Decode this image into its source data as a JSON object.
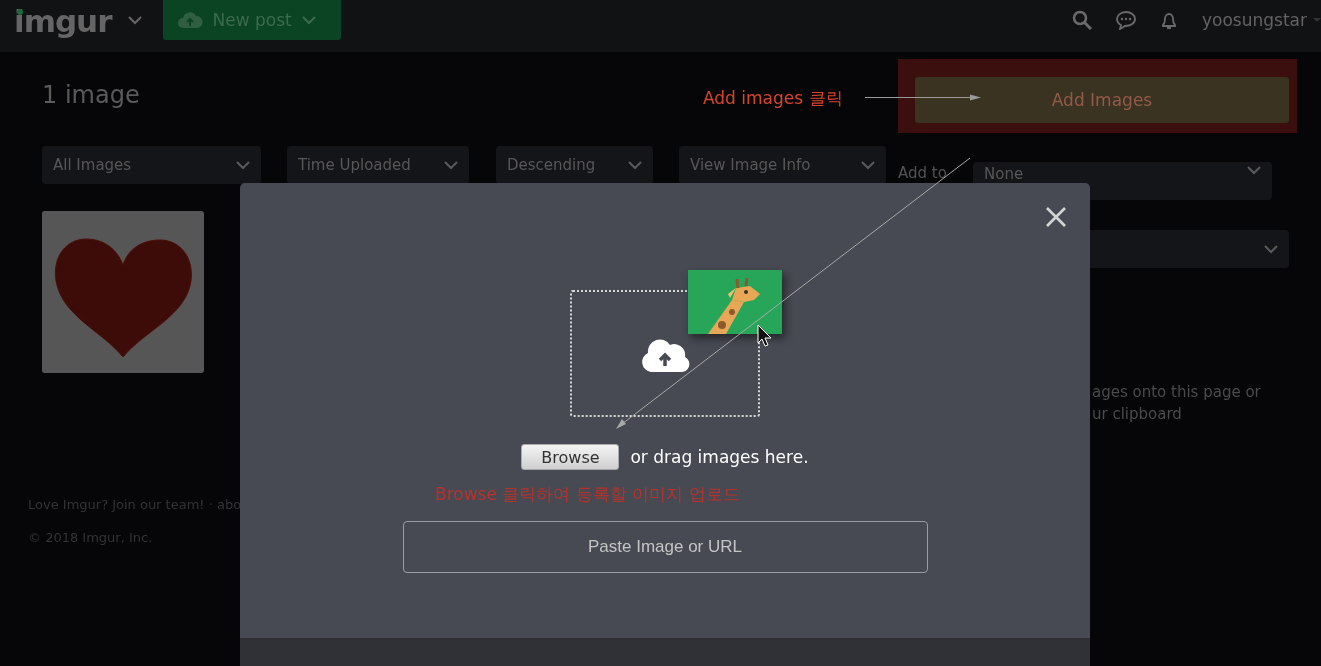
{
  "header": {
    "logo": "imgur",
    "new_post": "New post",
    "username": "yoosungstar"
  },
  "page": {
    "title": "1 image",
    "filters": [
      {
        "label": "All Images"
      },
      {
        "label": "Time Uploaded"
      },
      {
        "label": "Descending"
      },
      {
        "label": "View Image Info"
      }
    ],
    "add_images": "Add Images",
    "add_to_label": "Add to",
    "add_to_value": "None",
    "drop_hint": [
      "ages onto this page or",
      "ur clipboard"
    ],
    "footer": [
      "Love Imgur? Join our team! · abo",
      "© 2018 Imgur, Inc."
    ]
  },
  "modal": {
    "browse": "Browse",
    "drag_text": "or drag images here.",
    "paste_placeholder": "Paste Image or URL"
  },
  "annotations": [
    {
      "text": "Add images 클릭"
    },
    {
      "text": "Browse 클릭하여 등록할 이미지 업로드"
    }
  ]
}
